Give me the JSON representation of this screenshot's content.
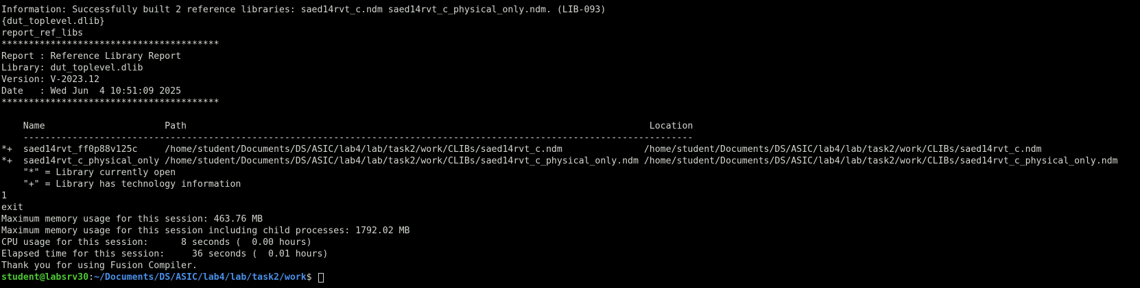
{
  "colors": {
    "background": "#000000",
    "foreground": "#d3d7cf",
    "prompt_user": "#4ec934",
    "prompt_path": "#4a8fe7"
  },
  "terminal": {
    "lines": [
      "Information: Successfully built 2 reference libraries: saed14rvt_c.ndm saed14rvt_c_physical_only.ndm. (LIB-093)",
      "{dut_toplevel.dlib}",
      "report_ref_libs",
      "****************************************",
      "Report : Reference Library Report",
      "Library: dut_toplevel.dlib",
      "Version: V-2023.12",
      "Date   : Wed Jun  4 10:51:09 2025",
      "****************************************",
      "",
      "    Name                      Path                                                                                     Location",
      "    ---------------------------------------------------------------------------------------------------------------------------",
      "*+  saed14rvt_ff0p88v125c     /home/student/Documents/DS/ASIC/lab4/lab/task2/work/CLIBs/saed14rvt_c.ndm               /home/student/Documents/DS/ASIC/lab4/lab/task2/work/CLIBs/saed14rvt_c.ndm",
      "*+  saed14rvt_c_physical_only /home/student/Documents/DS/ASIC/lab4/lab/task2/work/CLIBs/saed14rvt_c_physical_only.ndm /home/student/Documents/DS/ASIC/lab4/lab/task2/work/CLIBs/saed14rvt_c_physical_only.ndm",
      "    \"*\" = Library currently open",
      "    \"+\" = Library has technology information",
      "1",
      "exit",
      "Maximum memory usage for this session: 463.76 MB",
      "Maximum memory usage for this session including child processes: 1792.02 MB",
      "CPU usage for this session:      8 seconds (  0.00 hours)",
      "Elapsed time for this session:     36 seconds (  0.01 hours)",
      "Thank you for using Fusion Compiler."
    ],
    "prompt": {
      "user_host": "student@labsrv30",
      "separator": ":",
      "path": "~/Documents/DS/ASIC/lab4/lab/task2/work",
      "symbol": "$ "
    }
  }
}
